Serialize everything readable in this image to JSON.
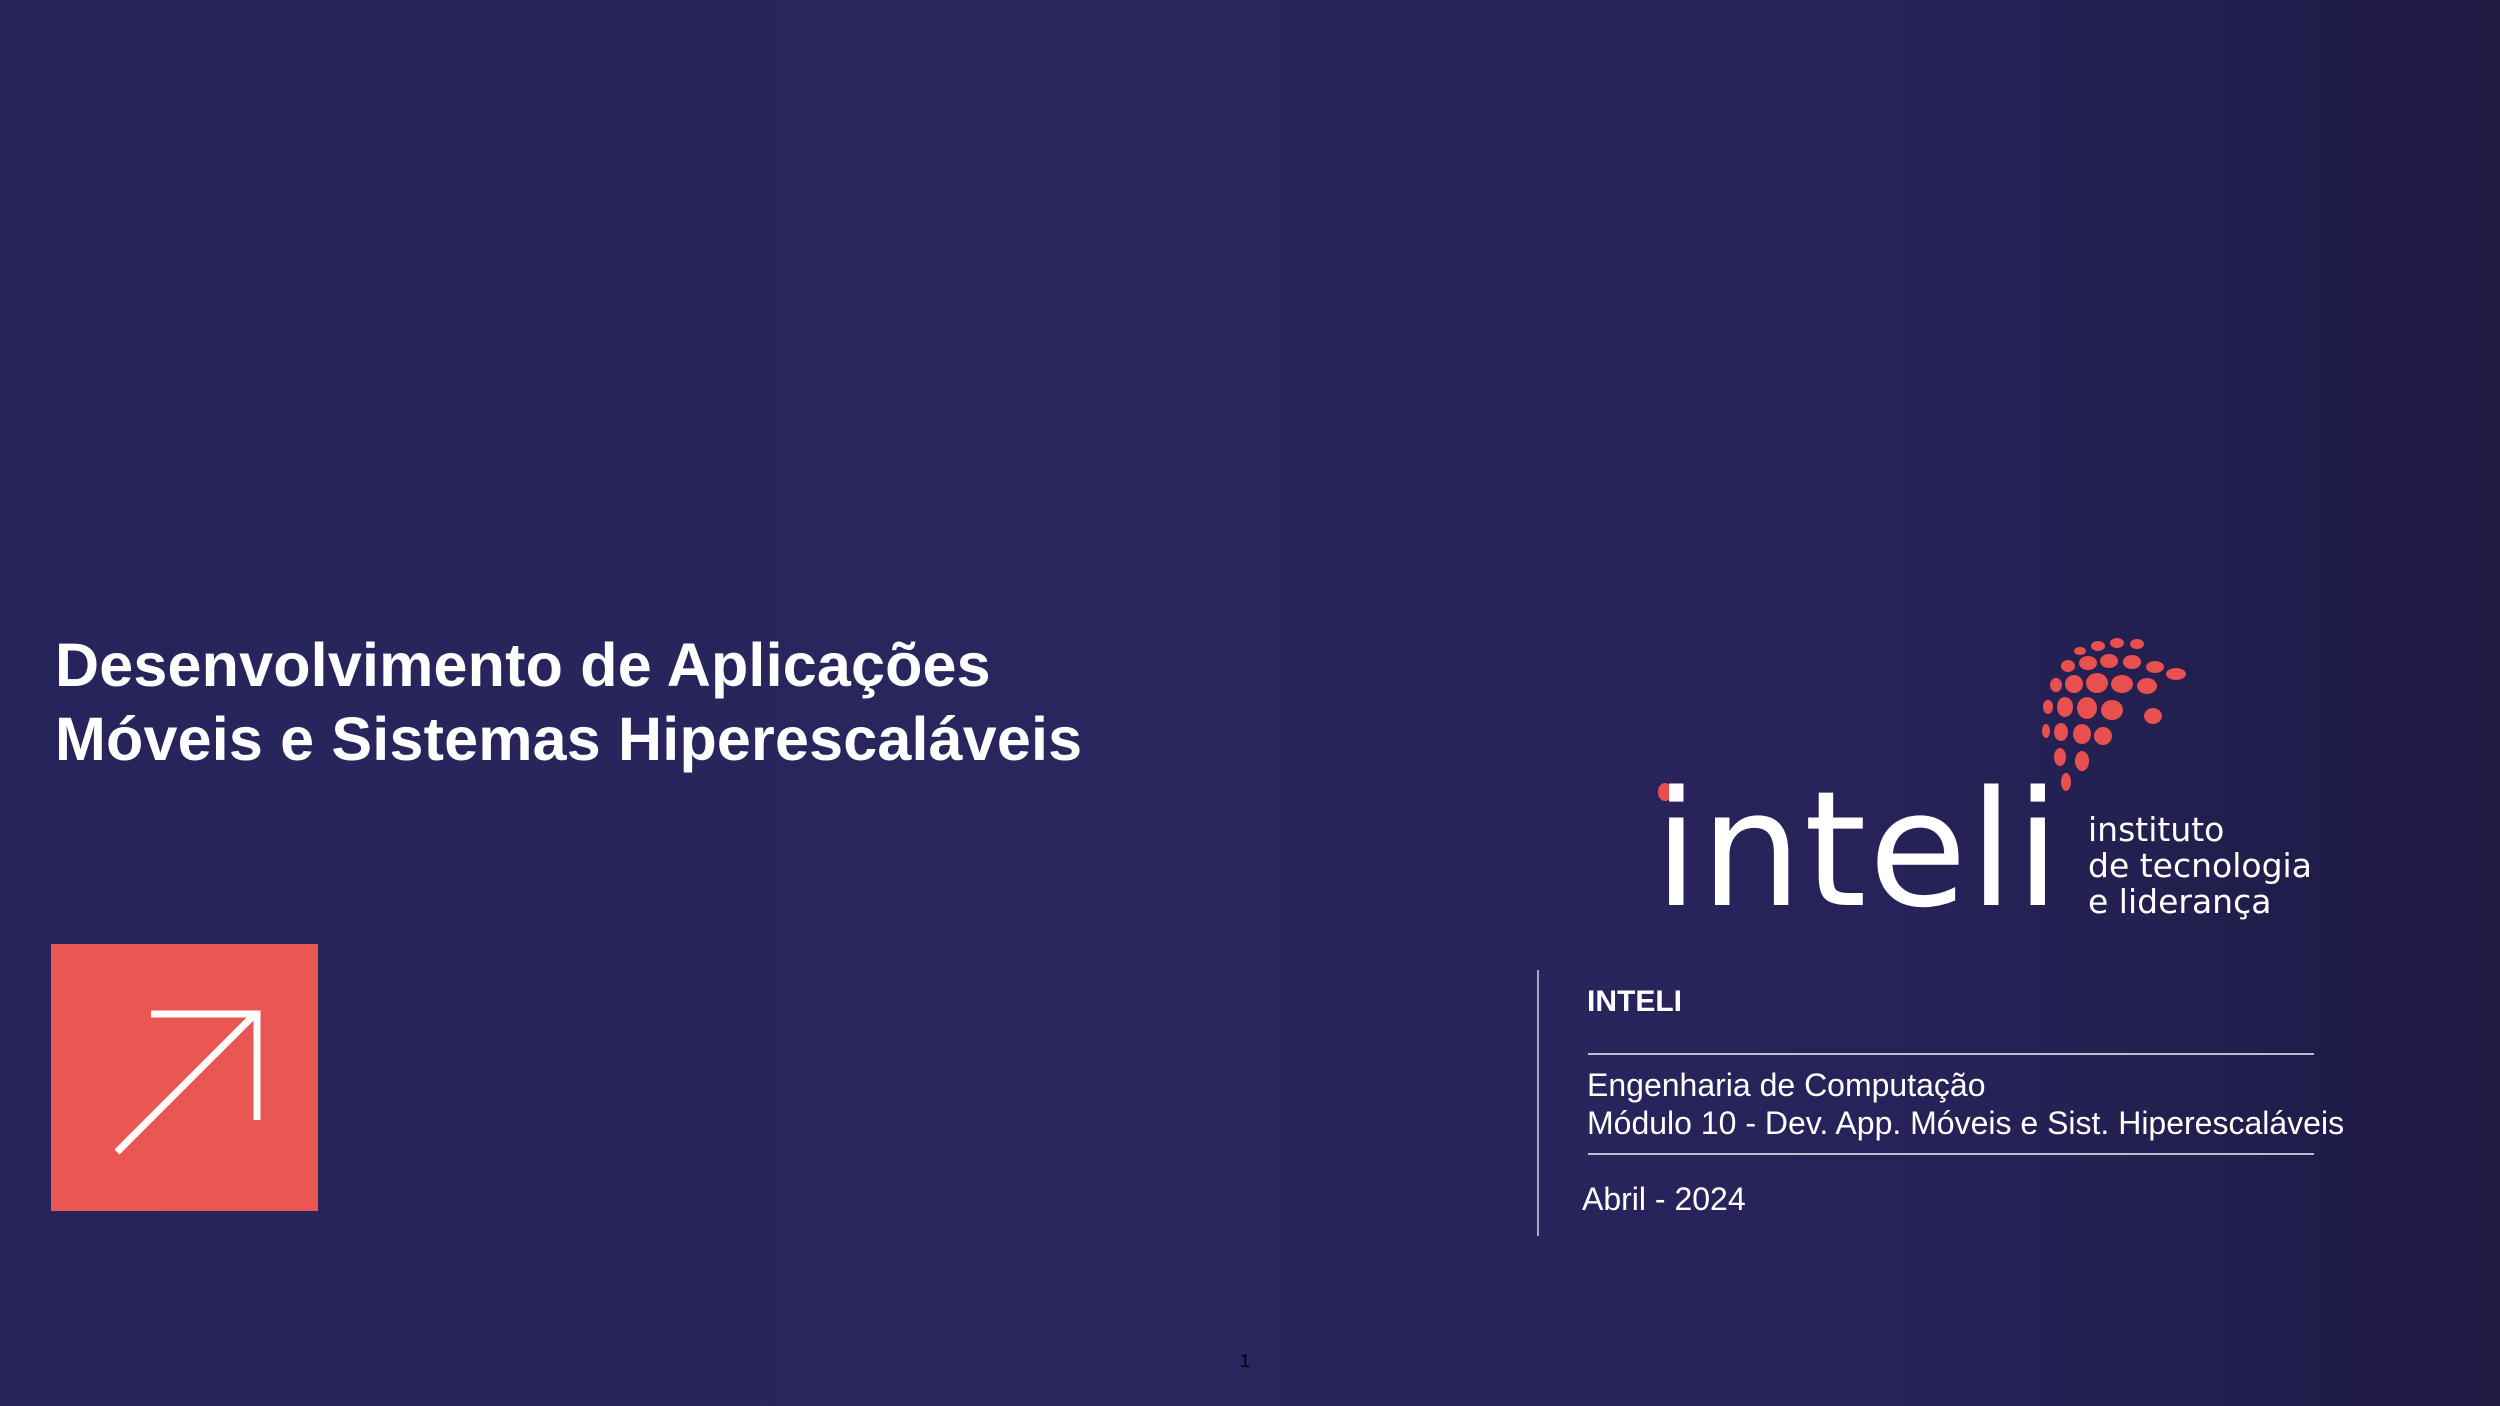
{
  "slide": {
    "title_lines": [
      "Desenvolvimento de Aplicações",
      "Móveis e Sistemas Hiperescaláveis"
    ],
    "arrow_icon": "arrow-up-right-icon",
    "logo": {
      "word": "inteli",
      "tagline_lines": [
        "instituto",
        "de tecnologia",
        "e liderança"
      ]
    },
    "institution": "INTELI",
    "program_lines": [
      "Engenharia de Computação",
      "Módulo 10 - Dev.  App. Móveis e Sist. Hiperescaláveis"
    ],
    "date": "Abril - 2024",
    "page_number": "1"
  },
  "colors": {
    "background": "#28255d",
    "accent": "#ea5651",
    "text": "#ffffff"
  }
}
